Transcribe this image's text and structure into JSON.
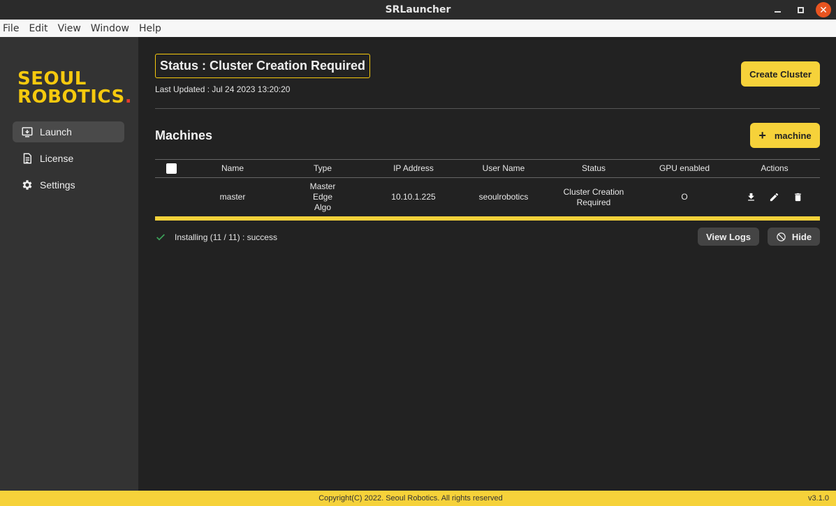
{
  "window": {
    "title": "SRLauncher",
    "close_glyph": "✕"
  },
  "menu": [
    "File",
    "Edit",
    "View",
    "Window",
    "Help"
  ],
  "brand": {
    "line1": "SEOUL",
    "line2": "ROBOTICS",
    "dot": ".",
    "colors": {
      "logo": "#f6c90e",
      "dot": "#e53b2c"
    }
  },
  "sidebar": {
    "items": [
      {
        "label": "Launch",
        "icon": "launch-icon",
        "active": true
      },
      {
        "label": "License",
        "icon": "license-icon",
        "active": false
      },
      {
        "label": "Settings",
        "icon": "gear-icon",
        "active": false
      }
    ]
  },
  "header": {
    "status": "Status : Cluster Creation Required",
    "last_updated": "Last Updated : Jul 24 2023 13:20:20",
    "create_cluster_label": "Create Cluster"
  },
  "machines": {
    "title": "Machines",
    "add_label": "machine",
    "add_icon": "+",
    "columns": [
      "Name",
      "Type",
      "IP Address",
      "User Name",
      "Status",
      "GPU enabled",
      "Actions"
    ],
    "rows": [
      {
        "name": "master",
        "type": "Master\nEdge\nAlgo",
        "ip": "10.10.1.225",
        "user": "seoulrobotics",
        "status": "Cluster Creation Required",
        "gpu": "O",
        "actions": [
          "download-icon",
          "edit-icon",
          "delete-icon"
        ]
      }
    ]
  },
  "install": {
    "message": "Installing (11 / 11) : success",
    "progress": 1.0,
    "view_logs_label": "View Logs",
    "hide_label": "Hide"
  },
  "footer": {
    "copyright": "Copyright(C) 2022. Seoul Robotics. All rights reserved",
    "version": "v3.1.0"
  },
  "colors": {
    "accent": "#f6d23a",
    "main_bg": "#222222",
    "sidebar_bg": "#333333",
    "success": "#3ca35a"
  }
}
